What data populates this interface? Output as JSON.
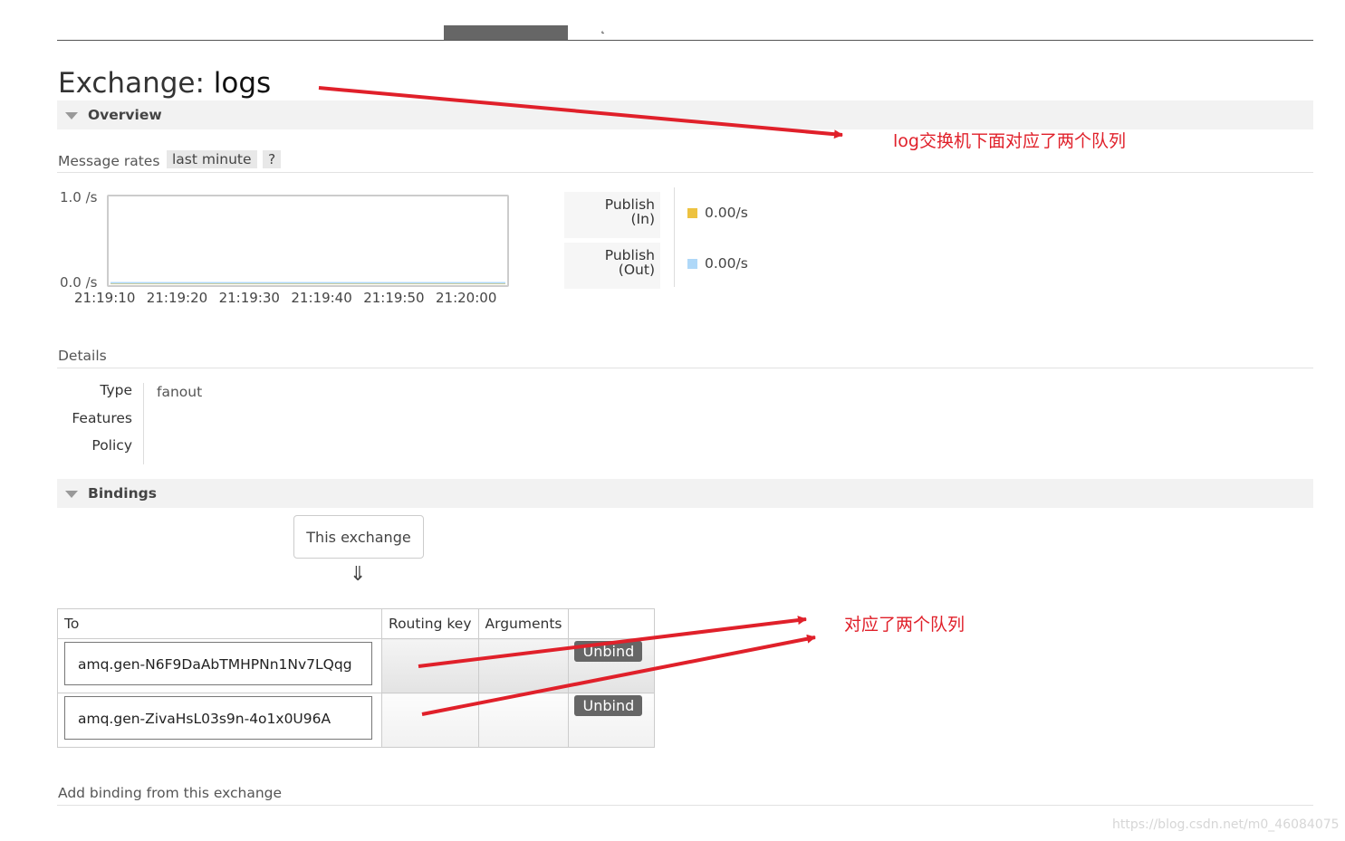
{
  "header": {
    "title_prefix": "Exchange:",
    "exchange_name": "logs"
  },
  "overview": {
    "section_label": "Overview",
    "message_rates_label": "Message rates",
    "range_pill": "last minute",
    "help_pill": "?",
    "chart_data": {
      "type": "line",
      "title": "",
      "ylabel": "",
      "xlabel": "",
      "ylim": [
        0,
        1
      ],
      "y_ticks": [
        "1.0 /s",
        "0.0 /s"
      ],
      "x": [
        "21:19:10",
        "21:19:20",
        "21:19:30",
        "21:19:40",
        "21:19:50",
        "21:20:00"
      ],
      "series": [
        {
          "name": "Publish (In)",
          "color": "#edc240",
          "values": [
            0,
            0,
            0,
            0,
            0,
            0
          ]
        },
        {
          "name": "Publish (Out)",
          "color": "#afd8f8",
          "values": [
            0,
            0,
            0,
            0,
            0,
            0
          ]
        }
      ]
    },
    "legend": [
      {
        "line1": "Publish",
        "line2": "(In)",
        "value": "0.00/s",
        "color": "#edc240"
      },
      {
        "line1": "Publish",
        "line2": "(Out)",
        "value": "0.00/s",
        "color": "#afd8f8"
      }
    ]
  },
  "details": {
    "section_label": "Details",
    "type_label": "Type",
    "type_value": "fanout",
    "features_label": "Features",
    "policy_label": "Policy"
  },
  "bindings": {
    "section_label": "Bindings",
    "this_exchange": "This exchange",
    "down_arrow": "⇓",
    "columns": [
      "To",
      "Routing key",
      "Arguments"
    ],
    "rows": [
      {
        "queue": "amq.gen-N6F9DaAbTMHPNn1Nv7LQqg",
        "routing_key": "",
        "arguments": "",
        "action": "Unbind"
      },
      {
        "queue": "amq.gen-ZivaHsL03s9n-4o1x0U96A",
        "routing_key": "",
        "arguments": "",
        "action": "Unbind"
      }
    ]
  },
  "add_binding": {
    "label": "Add binding from this exchange"
  },
  "annotations": {
    "note_top": "log交换机下面对应了两个队列",
    "note_bindings": "对应了两个队列",
    "color": "#e0202a"
  },
  "watermark": "https://blog.csdn.net/m0_46084075"
}
